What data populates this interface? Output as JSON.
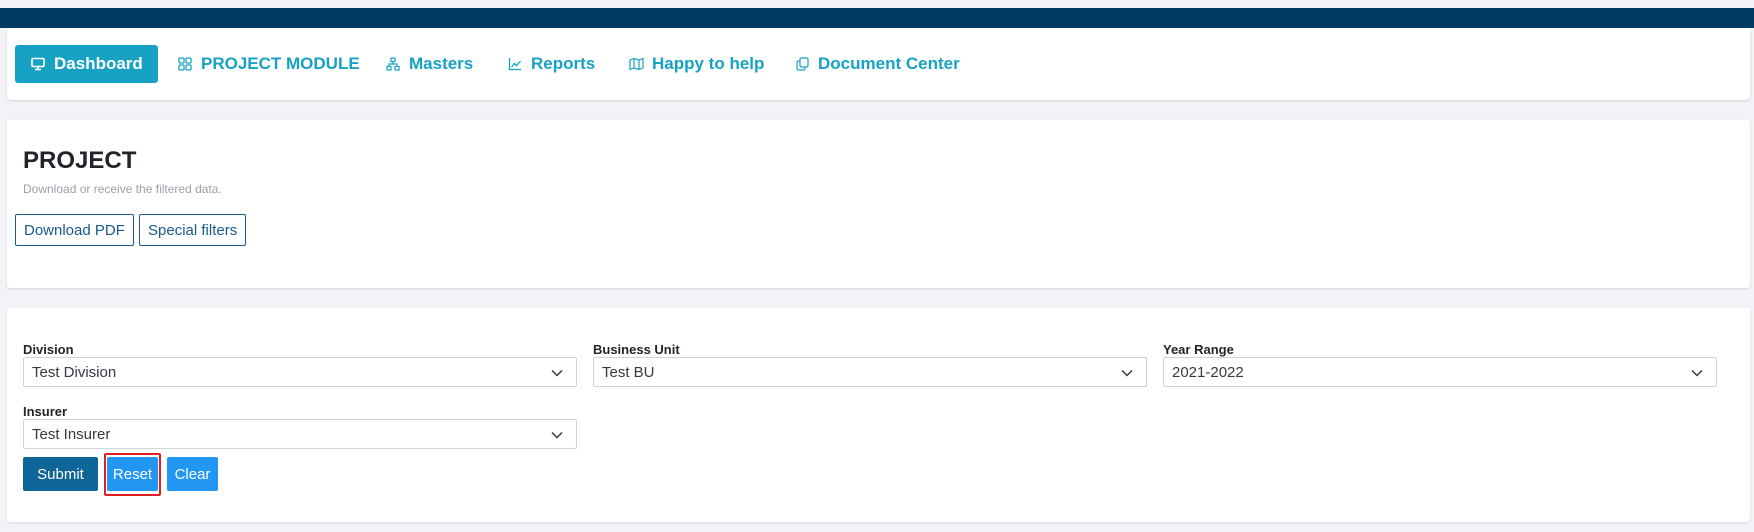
{
  "nav": {
    "items": [
      {
        "label": "Dashboard",
        "icon": "monitor-icon"
      },
      {
        "label": "PROJECT MODULE",
        "icon": "grid-icon"
      },
      {
        "label": "Masters",
        "icon": "sitemap-icon"
      },
      {
        "label": "Reports",
        "icon": "chart-line-icon"
      },
      {
        "label": "Happy to help",
        "icon": "map-icon"
      },
      {
        "label": "Document Center",
        "icon": "copy-icon"
      }
    ]
  },
  "project": {
    "title": "PROJECT",
    "subtitle": "Download or receive the filtered data.",
    "download_pdf": "Download PDF",
    "special_filters": "Special filters"
  },
  "filters": {
    "division": {
      "label": "Division",
      "value": "Test Division"
    },
    "business_unit": {
      "label": "Business Unit",
      "value": "Test BU"
    },
    "year_range": {
      "label": "Year Range",
      "value": "2021-2022"
    },
    "insurer": {
      "label": "Insurer",
      "value": "Test Insurer"
    }
  },
  "actions": {
    "submit": "Submit",
    "reset": "Reset",
    "clear": "Clear"
  },
  "colors": {
    "topbar": "#003a65",
    "accent": "#17a2c4",
    "submit": "#0d6697",
    "reset_clear": "#2196f3",
    "highlight": "#e02020"
  }
}
